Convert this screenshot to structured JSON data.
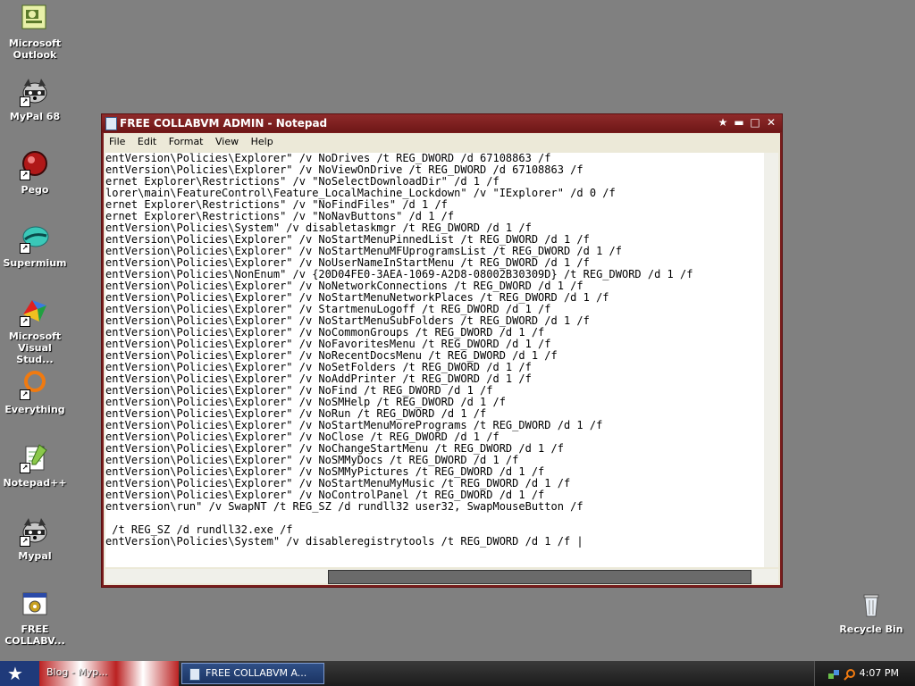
{
  "desktop": {
    "icons": [
      {
        "label": "Microsoft Outlook",
        "icon": "outlook-icon",
        "shortcut": false
      },
      {
        "label": "MyPal 68",
        "icon": "raccoon-icon",
        "shortcut": true
      },
      {
        "label": "Pego",
        "icon": "pego-icon",
        "shortcut": true
      },
      {
        "label": "Supermium",
        "icon": "supermium-icon",
        "shortcut": true
      },
      {
        "label": "Microsoft Visual Stud...",
        "icon": "visual-studio-icon",
        "shortcut": true
      },
      {
        "label": "Everything",
        "icon": "everything-icon",
        "shortcut": true
      },
      {
        "label": "Notepad++",
        "icon": "notepadpp-icon",
        "shortcut": true
      },
      {
        "label": "Mypal",
        "icon": "raccoon-icon",
        "shortcut": true
      },
      {
        "label": "FREE COLLABV...",
        "icon": "batch-file-icon",
        "shortcut": false
      }
    ],
    "recycle_bin": {
      "label": "Recycle Bin",
      "icon": "recycle-bin-icon"
    }
  },
  "window": {
    "title": "FREE COLLABVM ADMIN - Notepad",
    "menu": [
      "File",
      "Edit",
      "Format",
      "View",
      "Help"
    ],
    "editor_lines": [
      "entVersion\\Policies\\Explorer\" /v NoDrives /t REG_DWORD /d 67108863 /f",
      "entVersion\\Policies\\Explorer\" /v NoViewOnDrive /t REG_DWORD /d 67108863 /f",
      "ernet Explorer\\Restrictions\" /v \"NoSelectDownloadDir\" /d 1 /f",
      "lorer\\main\\FeatureControl\\Feature_LocalMachine_Lockdown\" /v \"IExplorer\" /d 0 /f",
      "ernet Explorer\\Restrictions\" /v \"NoFindFiles\" /d 1 /f",
      "ernet Explorer\\Restrictions\" /v \"NoNavButtons\" /d 1 /f",
      "entVersion\\Policies\\System\" /v disabletaskmgr /t REG_DWORD /d 1 /f",
      "entVersion\\Policies\\Explorer\" /v NoStartMenuPinnedList /t REG_DWORD /d 1 /f",
      "entVersion\\Policies\\Explorer\" /v NoStartMenuMFUprogramsList /t REG_DWORD /d 1 /f",
      "entVersion\\Policies\\Explorer\" /v NoUserNameInStartMenu /t REG_DWORD /d 1 /f",
      "entVersion\\Policies\\NonEnum\" /v {20D04FE0-3AEA-1069-A2D8-08002B30309D} /t REG_DWORD /d 1 /f",
      "entVersion\\Policies\\Explorer\" /v NoNetworkConnections /t REG_DWORD /d 1 /f",
      "entVersion\\Policies\\Explorer\" /v NoStartMenuNetworkPlaces /t REG_DWORD /d 1 /f",
      "entVersion\\Policies\\Explorer\" /v StartmenuLogoff /t REG_DWORD /d 1 /f",
      "entVersion\\Policies\\Explorer\" /v NoStartMenuSubFolders /t REG_DWORD /d 1 /f",
      "entVersion\\Policies\\Explorer\" /v NoCommonGroups /t REG_DWORD /d 1 /f",
      "entVersion\\Policies\\Explorer\" /v NoFavoritesMenu /t REG_DWORD /d 1 /f",
      "entVersion\\Policies\\Explorer\" /v NoRecentDocsMenu /t REG_DWORD /d 1 /f",
      "entVersion\\Policies\\Explorer\" /v NoSetFolders /t REG_DWORD /d 1 /f",
      "entVersion\\Policies\\Explorer\" /v NoAddPrinter /t REG_DWORD /d 1 /f",
      "entVersion\\Policies\\Explorer\" /v NoFind /t REG_DWORD /d 1 /f",
      "entVersion\\Policies\\Explorer\" /v NoSMHelp /t REG_DWORD /d 1 /f",
      "entVersion\\Policies\\Explorer\" /v NoRun /t REG_DWORD /d 1 /f",
      "entVersion\\Policies\\Explorer\" /v NoStartMenuMorePrograms /t REG_DWORD /d 1 /f",
      "entVersion\\Policies\\Explorer\" /v NoClose /t REG_DWORD /d 1 /f",
      "entVersion\\Policies\\Explorer\" /v NoChangeStartMenu /t REG_DWORD /d 1 /f",
      "entVersion\\Policies\\Explorer\" /v NoSMMyDocs /t REG_DWORD /d 1 /f",
      "entVersion\\Policies\\Explorer\" /v NoSMMyPictures /t REG_DWORD /d 1 /f",
      "entVersion\\Policies\\Explorer\" /v NoStartMenuMyMusic /t REG_DWORD /d 1 /f",
      "entVersion\\Policies\\Explorer\" /v NoControlPanel /t REG_DWORD /d 1 /f",
      "entversion\\run\" /v SwapNT /t REG_SZ /d rundll32 user32, SwapMouseButton /f",
      "",
      " /t REG_SZ /d rundll32.exe /f",
      "entVersion\\Policies\\System\" /v disableregistrytools /t REG_DWORD /d 1 /f |"
    ]
  },
  "taskbar": {
    "quick_launch_text": "Blog - Myp...",
    "active_task": "FREE COLLABVM A...",
    "clock": "4:07 PM"
  }
}
